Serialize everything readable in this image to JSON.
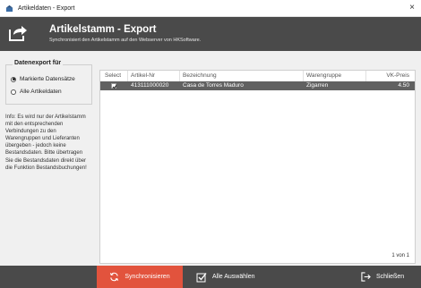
{
  "window": {
    "title": "Artikeldaten - Export",
    "close_glyph": "×"
  },
  "banner": {
    "title": "Artikelstamm - Export",
    "subtitle": "Synchronisiert den Artikelstamm auf den Webserver von HKSoftware.",
    "icon": "export-arrow-icon"
  },
  "export_group": {
    "legend": "Datenexport für",
    "options": [
      {
        "label": "Markierte Datensätze",
        "selected": true
      },
      {
        "label": "Alle Artikeldaten",
        "selected": false
      }
    ]
  },
  "info_text": "Info: Es wird nur der Artikelstamm mit den entsprechenden Verbindungen zu den Warengruppen und Lieferanten übergeben - jedoch keine Bestandsdaten. Bitte übertragen Sie die Bestandsdaten direkt über die Funktion Bestandsbuchungen!",
  "grid": {
    "columns": [
      "Select",
      "Artikel-Nr",
      "Bezeichnung",
      "Warengruppe",
      "VK-Preis"
    ],
    "rows": [
      {
        "selected": true,
        "artikel_nr": "413111000020",
        "bezeichnung": "Casa de Torres Maduro",
        "warengruppe": "Zigarren",
        "vk_preis": "4.50"
      }
    ],
    "pager": "1 von 1"
  },
  "footer": {
    "sync_label": "Synchronisieren",
    "select_all_label": "Alle Auswählen",
    "close_label": "Schließen"
  },
  "colors": {
    "banner": "#4a4a4a",
    "accent": "#e2533d",
    "selected_row": "#616161"
  }
}
